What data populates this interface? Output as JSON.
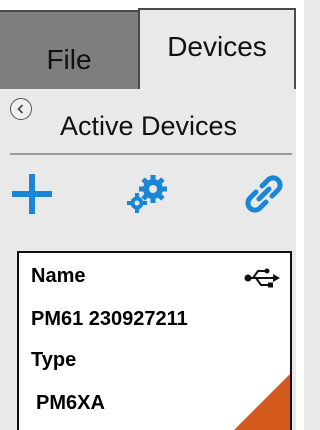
{
  "tabs": {
    "file_label": "File",
    "devices_label": "Devices",
    "active": "Devices"
  },
  "panel": {
    "title": "Active Devices",
    "back_icon": "chevron-left-circle-icon"
  },
  "toolbar": {
    "add_icon": "plus-icon",
    "settings_icon": "gear-icon",
    "link_icon": "link-icon",
    "accent_color": "#1a86d8"
  },
  "device": {
    "name_label": "Name",
    "name_value": "PM61 230927211",
    "type_label": "Type",
    "type_value": "PM6XA",
    "connection_icon": "usb-icon",
    "status_color": "#d35a1c"
  }
}
